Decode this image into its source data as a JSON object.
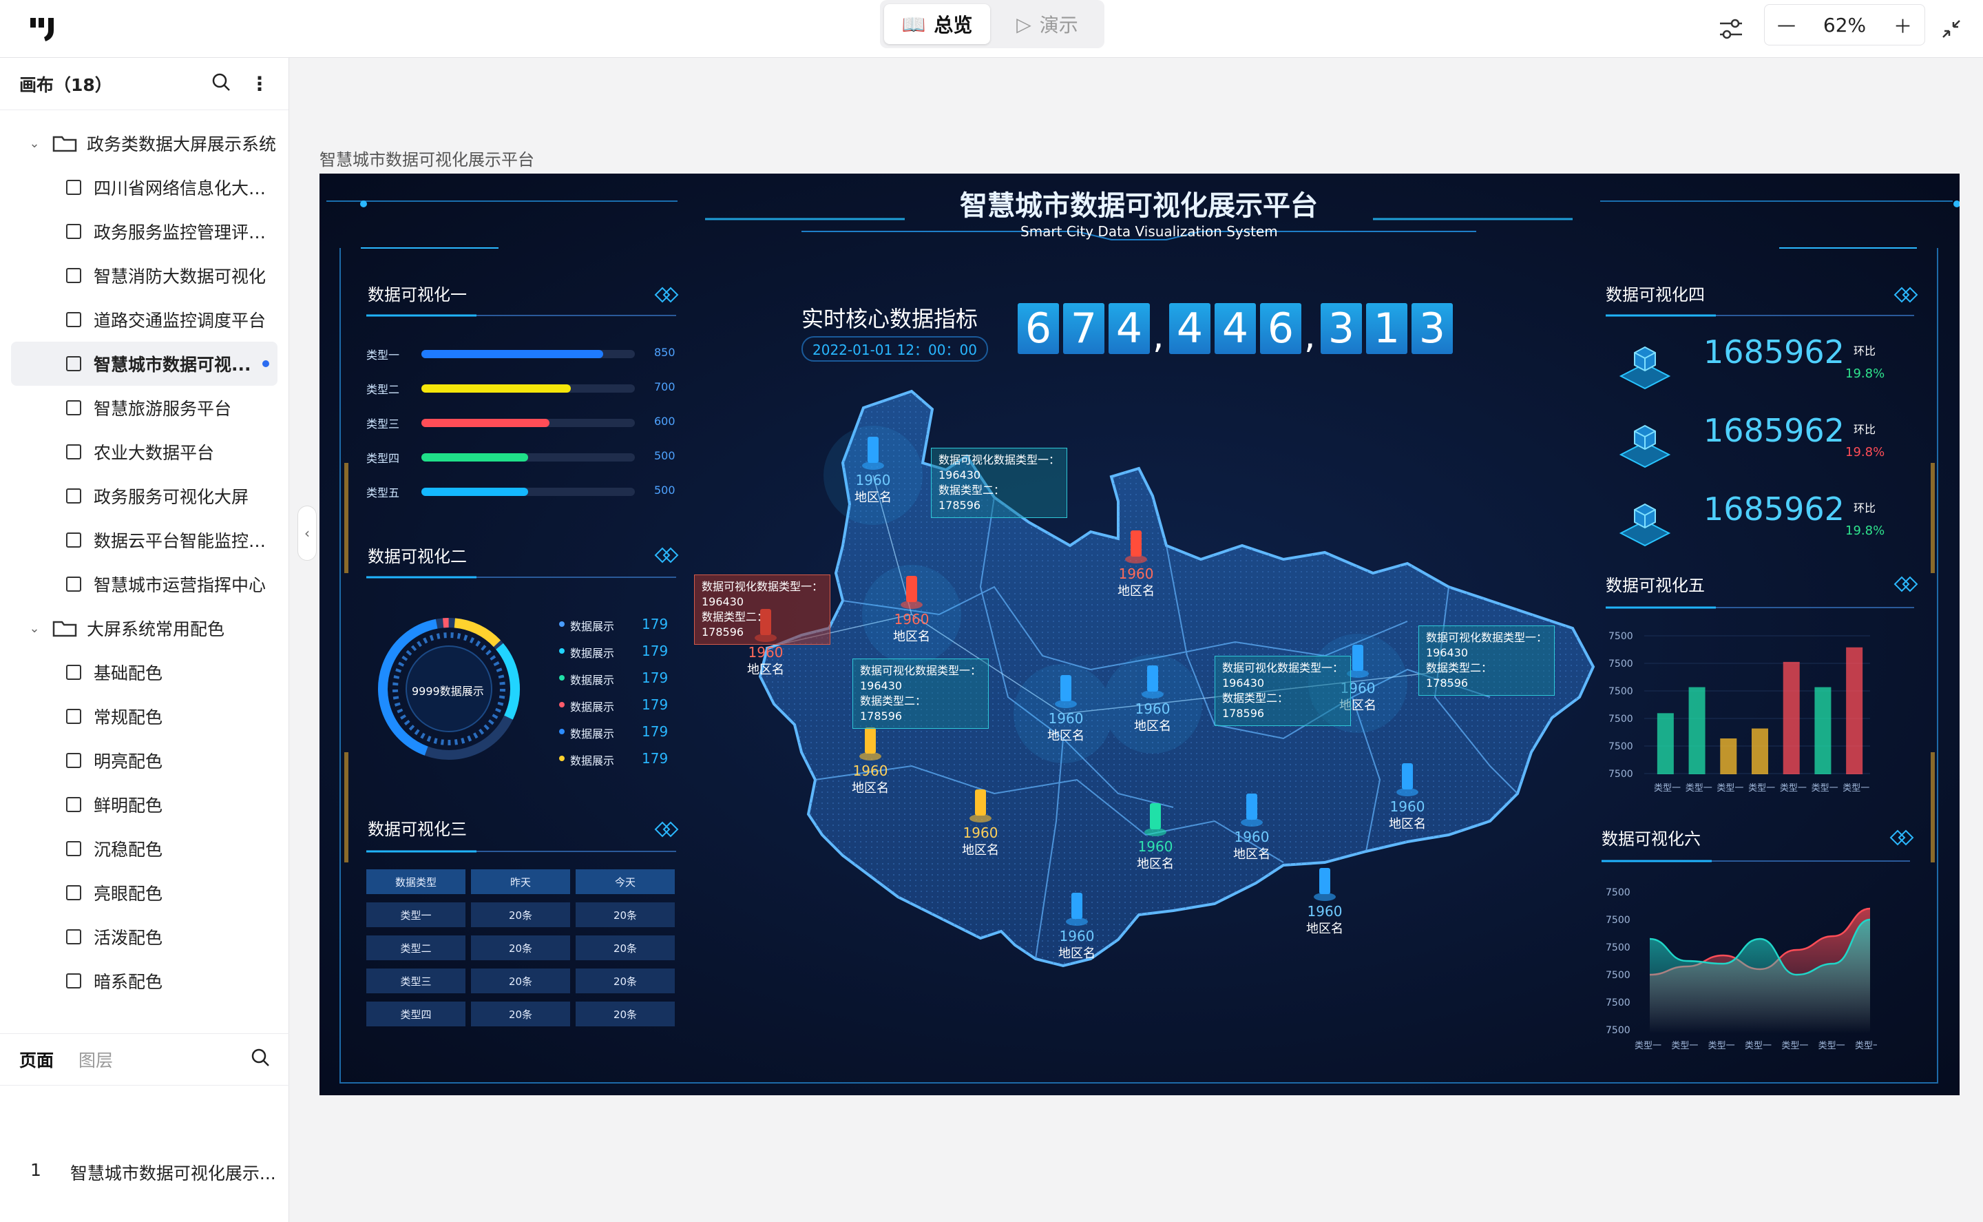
{
  "topbar": {
    "tab_overview": "总览",
    "tab_demo": "演示",
    "zoom": "62%"
  },
  "sidebar": {
    "title": "画布（18）",
    "folders": [
      {
        "label": "政务类数据大屏展示系统",
        "items": [
          "四川省网络信息化大数...",
          "政务服务监控管理评价...",
          "智慧消防大数据可视化",
          "道路交通监控调度平台",
          "智慧城市数据可视...",
          "智慧旅游服务平台",
          "农业大数据平台",
          "政务服务可视化大屏",
          "数据云平台智能监控系统",
          "智慧城市运营指挥中心"
        ]
      },
      {
        "label": "大屏系统常用配色",
        "items": [
          "基础配色",
          "常规配色",
          "明亮配色",
          "鲜明配色",
          "沉稳配色",
          "亮眼配色",
          "活泼配色",
          "暗系配色"
        ]
      }
    ],
    "tab_pages": "页面",
    "tab_layers": "图层",
    "page_index": "1",
    "page_name": "智慧城市数据可视化展示..."
  },
  "canvas": {
    "label": "智慧城市数据可视化展示平台"
  },
  "dashboard": {
    "title": "智慧城市数据可视化展示平台",
    "subtitle": "Smart City Data Visualization System",
    "realtime_label": "实时核心数据指标",
    "realtime_time": "2022-01-01  12：00：00",
    "digits": [
      "6",
      "7",
      "4",
      "4",
      "4",
      "6",
      "3",
      "1",
      "3"
    ],
    "panel1": {
      "title": "数据可视化一",
      "rows": [
        {
          "label": "类型一",
          "value": 850,
          "color": "#1e7bff"
        },
        {
          "label": "类型二",
          "value": 700,
          "color": "#f5e60a"
        },
        {
          "label": "类型三",
          "value": 600,
          "color": "#ff4d57"
        },
        {
          "label": "类型四",
          "value": 500,
          "color": "#1fe089"
        },
        {
          "label": "类型五",
          "value": 500,
          "color": "#14b8ff"
        }
      ],
      "max": 1000
    },
    "panel2": {
      "title": "数据可视化二",
      "center": "9999数据展示",
      "legend": [
        {
          "label": "数据展示",
          "value": "179",
          "color": "#4a9dff"
        },
        {
          "label": "数据展示",
          "value": "179",
          "color": "#21d4ff"
        },
        {
          "label": "数据展示",
          "value": "179",
          "color": "#20e0a8"
        },
        {
          "label": "数据展示",
          "value": "179",
          "color": "#ff5b6b"
        },
        {
          "label": "数据展示",
          "value": "179",
          "color": "#2c8cff"
        },
        {
          "label": "数据展示",
          "value": "179",
          "color": "#ffd22e"
        }
      ]
    },
    "panel3": {
      "title": "数据可视化三",
      "header": [
        "数据类型",
        "昨天",
        "今天"
      ],
      "rows": [
        [
          "类型一",
          "20条",
          "20条"
        ],
        [
          "类型二",
          "20条",
          "20条"
        ],
        [
          "类型三",
          "20条",
          "20条"
        ],
        [
          "类型四",
          "20条",
          "20条"
        ]
      ]
    },
    "panel4": {
      "title": "数据可视化四",
      "stats": [
        {
          "value": "1685962",
          "change_label": "环比",
          "change": "19.8%",
          "color": "#2fe38d"
        },
        {
          "value": "1685962",
          "change_label": "环比",
          "change": "19.8%",
          "color": "#ff4d57"
        },
        {
          "value": "1685962",
          "change_label": "环比",
          "change": "19.8%",
          "color": "#2fe38d"
        }
      ]
    },
    "panel5": {
      "title": "数据可视化五"
    },
    "panel6": {
      "title": "数据可视化六"
    },
    "map": {
      "pins": [
        {
          "num": "1960",
          "name": "地区名",
          "color": "#2aa3ff"
        },
        {
          "num": "1960",
          "name": "地区名",
          "color": "#ff4d3a"
        },
        {
          "num": "1960",
          "name": "地区名",
          "color": "#ff4d3a"
        },
        {
          "num": "1960",
          "name": "地区名",
          "color": "#ff4d3a"
        },
        {
          "num": "1960",
          "name": "地区名",
          "color": "#ffc02a"
        },
        {
          "num": "1960",
          "name": "地区名",
          "color": "#2aa3ff"
        },
        {
          "num": "1960",
          "name": "地区名",
          "color": "#2aa3ff"
        },
        {
          "num": "1960",
          "name": "地区名",
          "color": "#2aa3ff"
        },
        {
          "num": "1960",
          "name": "地区名",
          "color": "#ffc02a"
        },
        {
          "num": "1960",
          "name": "地区名",
          "color": "#20e0a8"
        },
        {
          "num": "1960",
          "name": "地区名",
          "color": "#2aa3ff"
        },
        {
          "num": "1960",
          "name": "地区名",
          "color": "#2aa3ff"
        },
        {
          "num": "1960",
          "name": "地区名",
          "color": "#2aa3ff"
        },
        {
          "num": "1960",
          "name": "地区名",
          "color": "#2aa3ff"
        }
      ],
      "tooltip": {
        "line1": "数据可视化数据类型一：",
        "val1": "196430",
        "line2": "数据类型二：",
        "val2": "178596"
      }
    }
  },
  "chart_data": [
    {
      "type": "bar",
      "panel": "数据可视化五",
      "categories": [
        "类型一",
        "类型一",
        "类型一",
        "类型一",
        "类型一",
        "类型一",
        "类型一"
      ],
      "y_tick_labels": [
        "7500",
        "7500",
        "7500",
        "7500",
        "7500",
        "7500"
      ],
      "values": [
        0.78,
        1.12,
        0.45,
        0.58,
        1.45,
        1.12,
        1.64
      ],
      "colors": [
        "#20e0a8",
        "#20e0a8",
        "#ffc02a",
        "#ffc02a",
        "#ff4d57",
        "#20e0a8",
        "#ff4d57"
      ]
    },
    {
      "type": "area",
      "panel": "数据可视化六",
      "categories": [
        "类型一",
        "类型一",
        "类型一",
        "类型一",
        "类型一",
        "类型一",
        "类型一"
      ],
      "y_tick_labels": [
        "7500",
        "7500",
        "7500",
        "7500",
        "7500",
        "7500"
      ],
      "series": [
        {
          "values": [
            2.0,
            2.3,
            2.7,
            2.2,
            2.9,
            3.4,
            4.4
          ],
          "color": "#ff4d57"
        },
        {
          "values": [
            3.3,
            2.5,
            2.4,
            3.3,
            2.0,
            2.4,
            4.0
          ],
          "color": "#20d6c8"
        }
      ]
    }
  ]
}
